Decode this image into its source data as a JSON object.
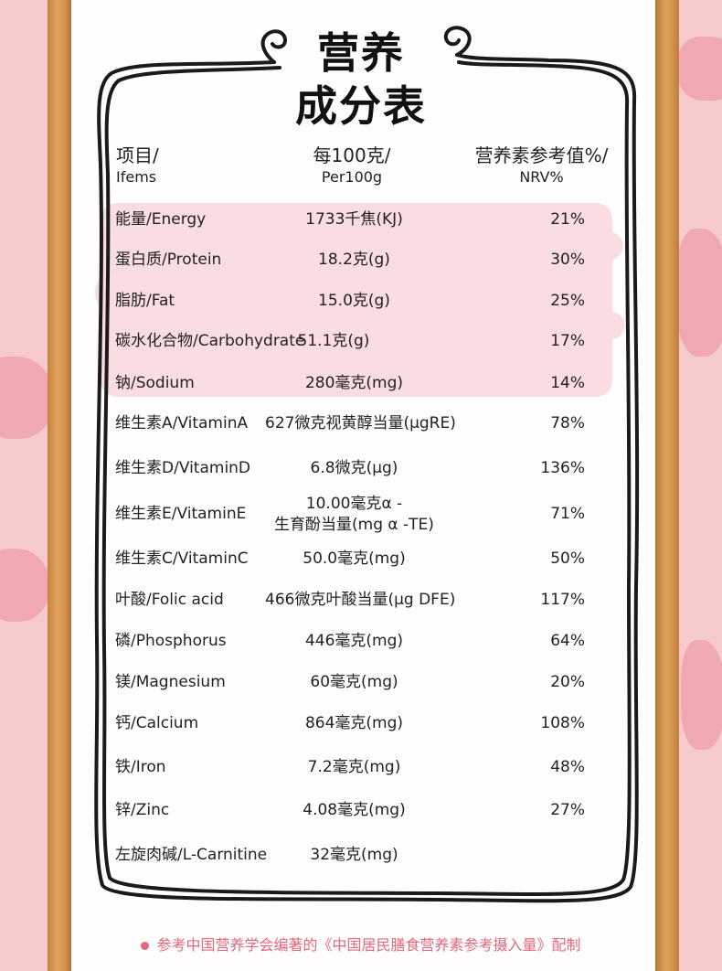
{
  "title": {
    "line1": "营养",
    "line2": "成分表"
  },
  "header": {
    "item_cn": "项目/",
    "item_en": "Ifems",
    "per_cn": "每100克/",
    "per_en": "Per100g",
    "nrv_cn": "营养素参考值%/",
    "nrv_en": "NRV%"
  },
  "rows": [
    {
      "name": "能量/Energy",
      "value": "1733千焦(KJ)",
      "nrv": "21%"
    },
    {
      "name": "蛋白质/Protein",
      "value": "18.2克(g)",
      "nrv": "30%"
    },
    {
      "name": "脂肪/Fat",
      "value": "15.0克(g)",
      "nrv": "25%"
    },
    {
      "name": "碳水化合物/Carbohydrate",
      "value": "51.1克(g)",
      "nrv": "17%"
    },
    {
      "name": "钠/Sodium",
      "value": "280毫克(mg)",
      "nrv": "14%"
    },
    {
      "name": "维生素A/VitaminA",
      "value": "627微克视黄醇当量(μgRE)",
      "nrv": "78%"
    },
    {
      "name": "维生素D/VitaminD",
      "value": "6.8微克(μg)",
      "nrv": "136%"
    },
    {
      "name": "维生素E/VitaminE",
      "value": "10.00毫克α -",
      "value2": "生育酚当量(mg α -TE)",
      "nrv": "71%"
    },
    {
      "name": "维生素C/VitaminC",
      "value": "50.0毫克(mg)",
      "nrv": "50%"
    },
    {
      "name": "叶酸/Folic acid",
      "value": "466微克叶酸当量(μg DFE)",
      "nrv": "117%"
    },
    {
      "name": "磷/Phosphorus",
      "value": "446毫克(mg)",
      "nrv": "64%"
    },
    {
      "name": "镁/Magnesium",
      "value": "60毫克(mg)",
      "nrv": "20%"
    },
    {
      "name": "钙/Calcium",
      "value": "864毫克(mg)",
      "nrv": "108%"
    },
    {
      "name": "铁/Iron",
      "value": "7.2毫克(mg)",
      "nrv": "48%"
    },
    {
      "name": "锌/Zinc",
      "value": "4.08毫克(mg)",
      "nrv": "27%"
    },
    {
      "name": "左旋肉碱/L-Carnitine",
      "value": "32毫克(mg)",
      "nrv": ""
    }
  ],
  "footer": "参考中国营养学会编著的《中国居民膳食营养素参考摄入量》配制",
  "colors": {
    "background": "#f6c9cd",
    "band": "#f9dde0",
    "footer": "#e3697b",
    "wood": "#d6954f"
  }
}
